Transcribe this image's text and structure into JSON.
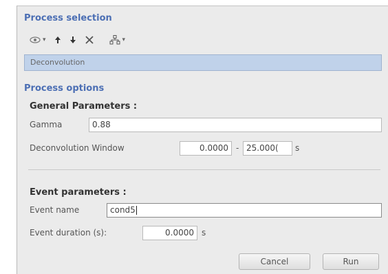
{
  "process_selection": {
    "title": "Process selection",
    "toolbar": {
      "icons": [
        "eye-menu-icon",
        "arrow-up-icon",
        "arrow-down-icon",
        "remove-icon",
        "pipeline-menu-icon"
      ]
    },
    "items": [
      {
        "label": "Deconvolution"
      }
    ]
  },
  "process_options": {
    "title": "Process options",
    "general": {
      "title": "General Parameters :",
      "gamma_label": "Gamma",
      "gamma_value": "0.88",
      "window_label": "Deconvolution Window",
      "window_start": "0.0000",
      "window_sep": "-",
      "window_end": "25.000(",
      "window_unit": "s"
    },
    "event": {
      "title": "Event parameters :",
      "name_label": "Event name",
      "name_value": "cond5",
      "duration_label": "Event duration (s):",
      "duration_value": "0.0000",
      "duration_unit": "s"
    }
  },
  "buttons": {
    "cancel": "Cancel",
    "run": "Run"
  },
  "colors": {
    "section_title": "#4c6fb4",
    "selected_row": "#c0d2ea"
  }
}
